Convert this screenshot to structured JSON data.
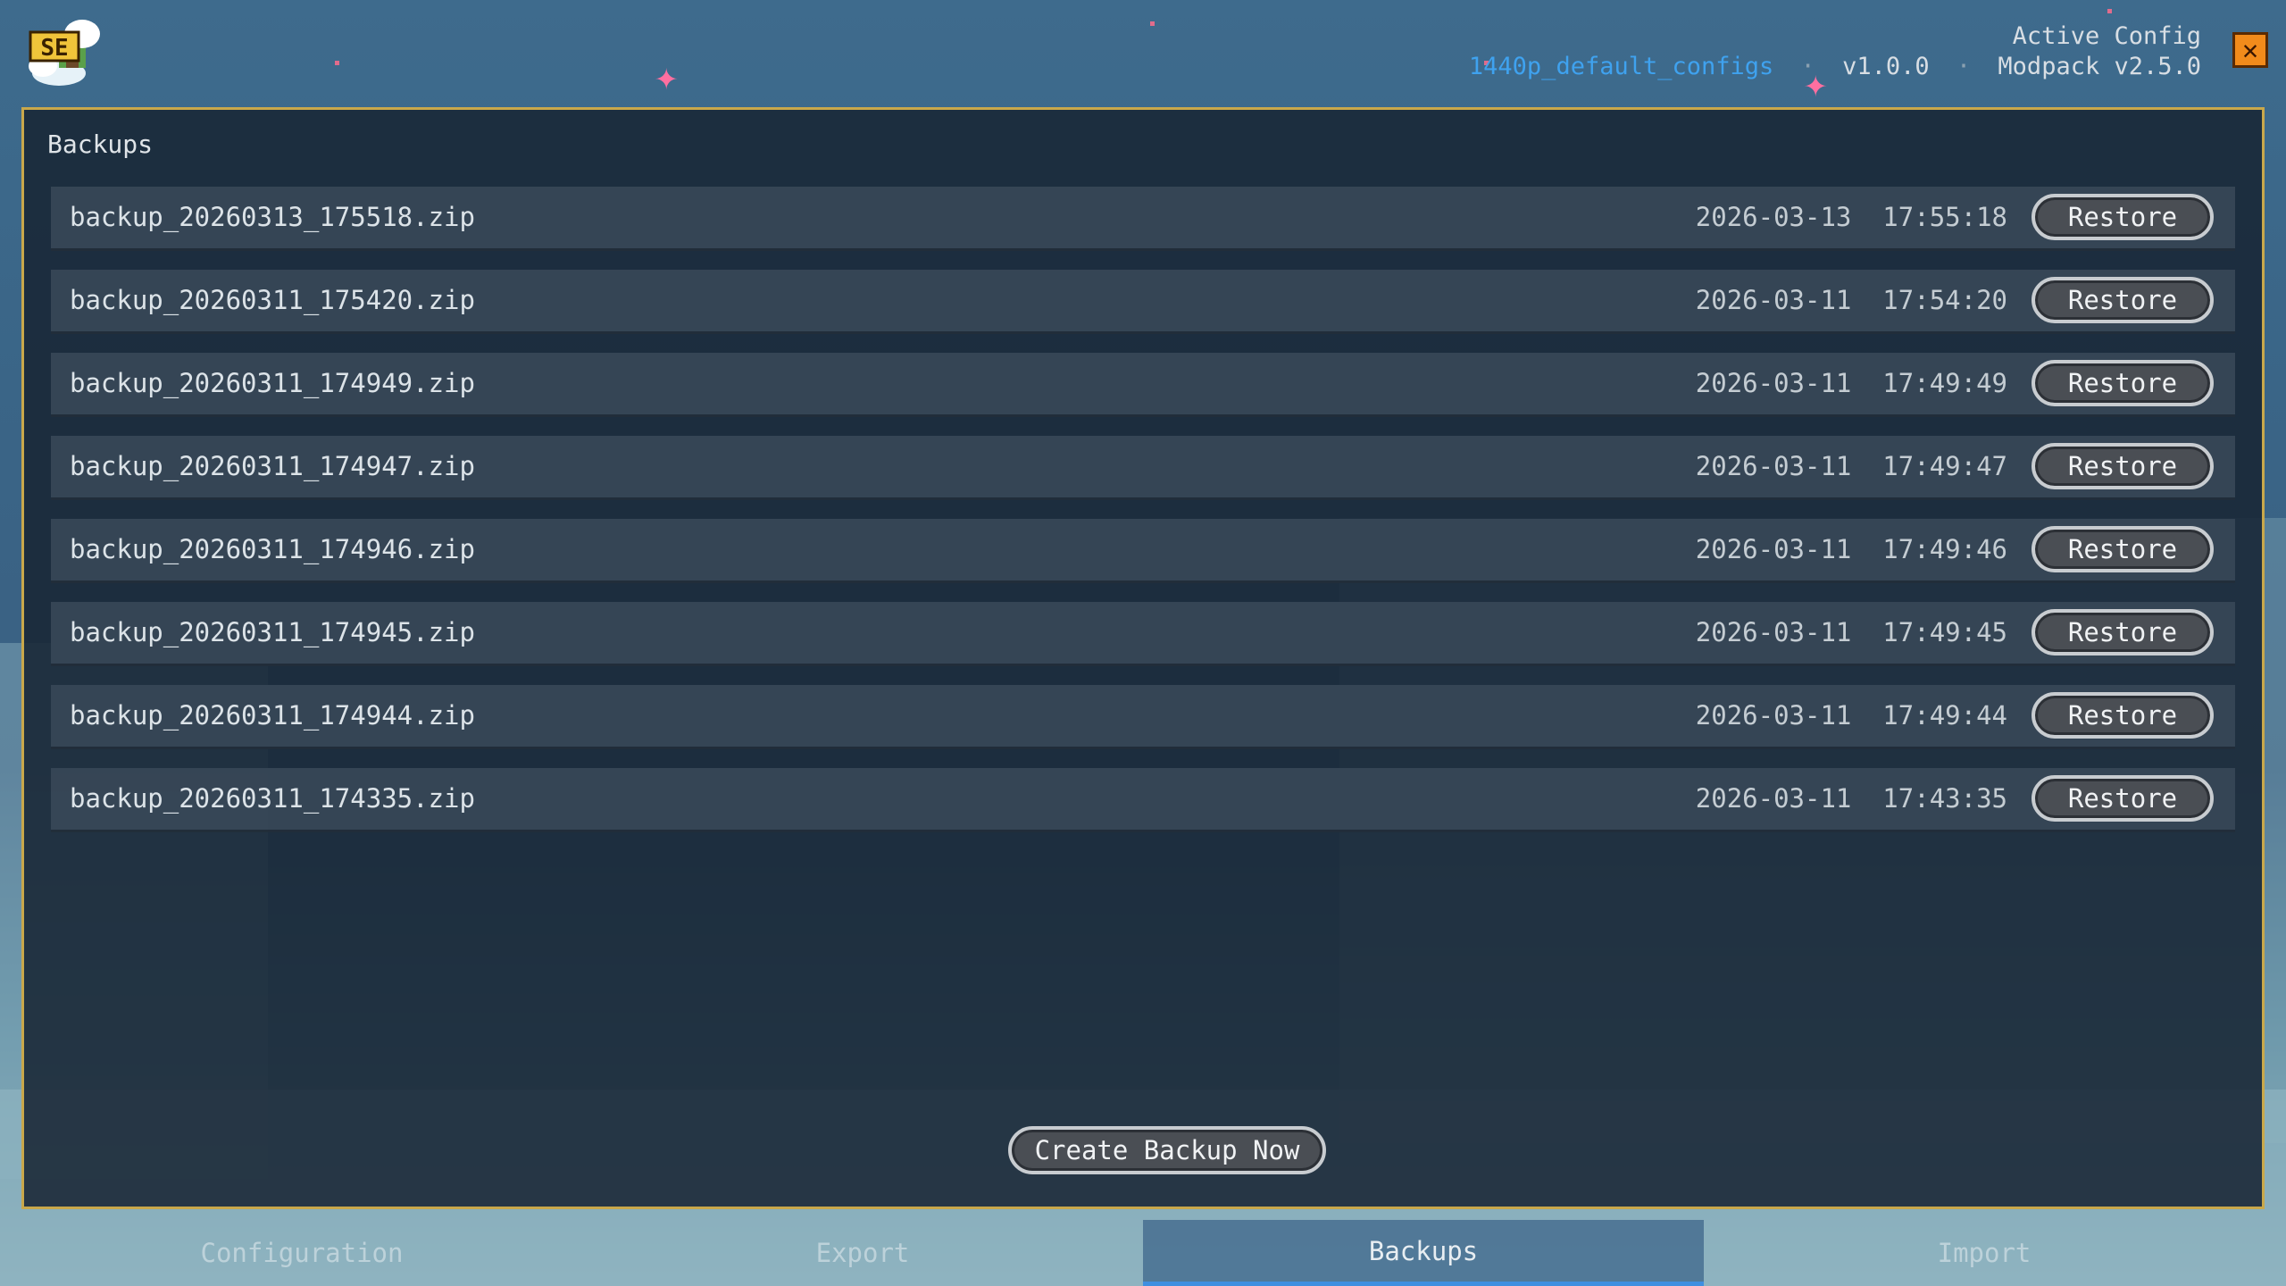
{
  "header": {
    "active_label": "Active Config",
    "config_name": "1440p_default_configs",
    "separator": "·",
    "version": "v1.0.0",
    "modpack": "Modpack v2.5.0",
    "close_glyph": "✕",
    "logo_text": "SE"
  },
  "panel": {
    "title": "Backups",
    "restore_label": "Restore",
    "create_label": "Create Backup Now"
  },
  "backups": [
    {
      "file": "backup_20260313_175518.zip",
      "date": "2026-03-13  17:55:18"
    },
    {
      "file": "backup_20260311_175420.zip",
      "date": "2026-03-11  17:54:20"
    },
    {
      "file": "backup_20260311_174949.zip",
      "date": "2026-03-11  17:49:49"
    },
    {
      "file": "backup_20260311_174947.zip",
      "date": "2026-03-11  17:49:47"
    },
    {
      "file": "backup_20260311_174946.zip",
      "date": "2026-03-11  17:49:46"
    },
    {
      "file": "backup_20260311_174945.zip",
      "date": "2026-03-11  17:49:45"
    },
    {
      "file": "backup_20260311_174944.zip",
      "date": "2026-03-11  17:49:44"
    },
    {
      "file": "backup_20260311_174335.zip",
      "date": "2026-03-11  17:43:35"
    }
  ],
  "tabs": [
    {
      "label": "Configuration",
      "active": false
    },
    {
      "label": "Export",
      "active": false
    },
    {
      "label": "Backups",
      "active": true
    },
    {
      "label": "Import",
      "active": false
    }
  ],
  "colors": {
    "accent": "#3fa2ef",
    "panel_border": "#c9a84b",
    "close": "#f28b1b"
  }
}
